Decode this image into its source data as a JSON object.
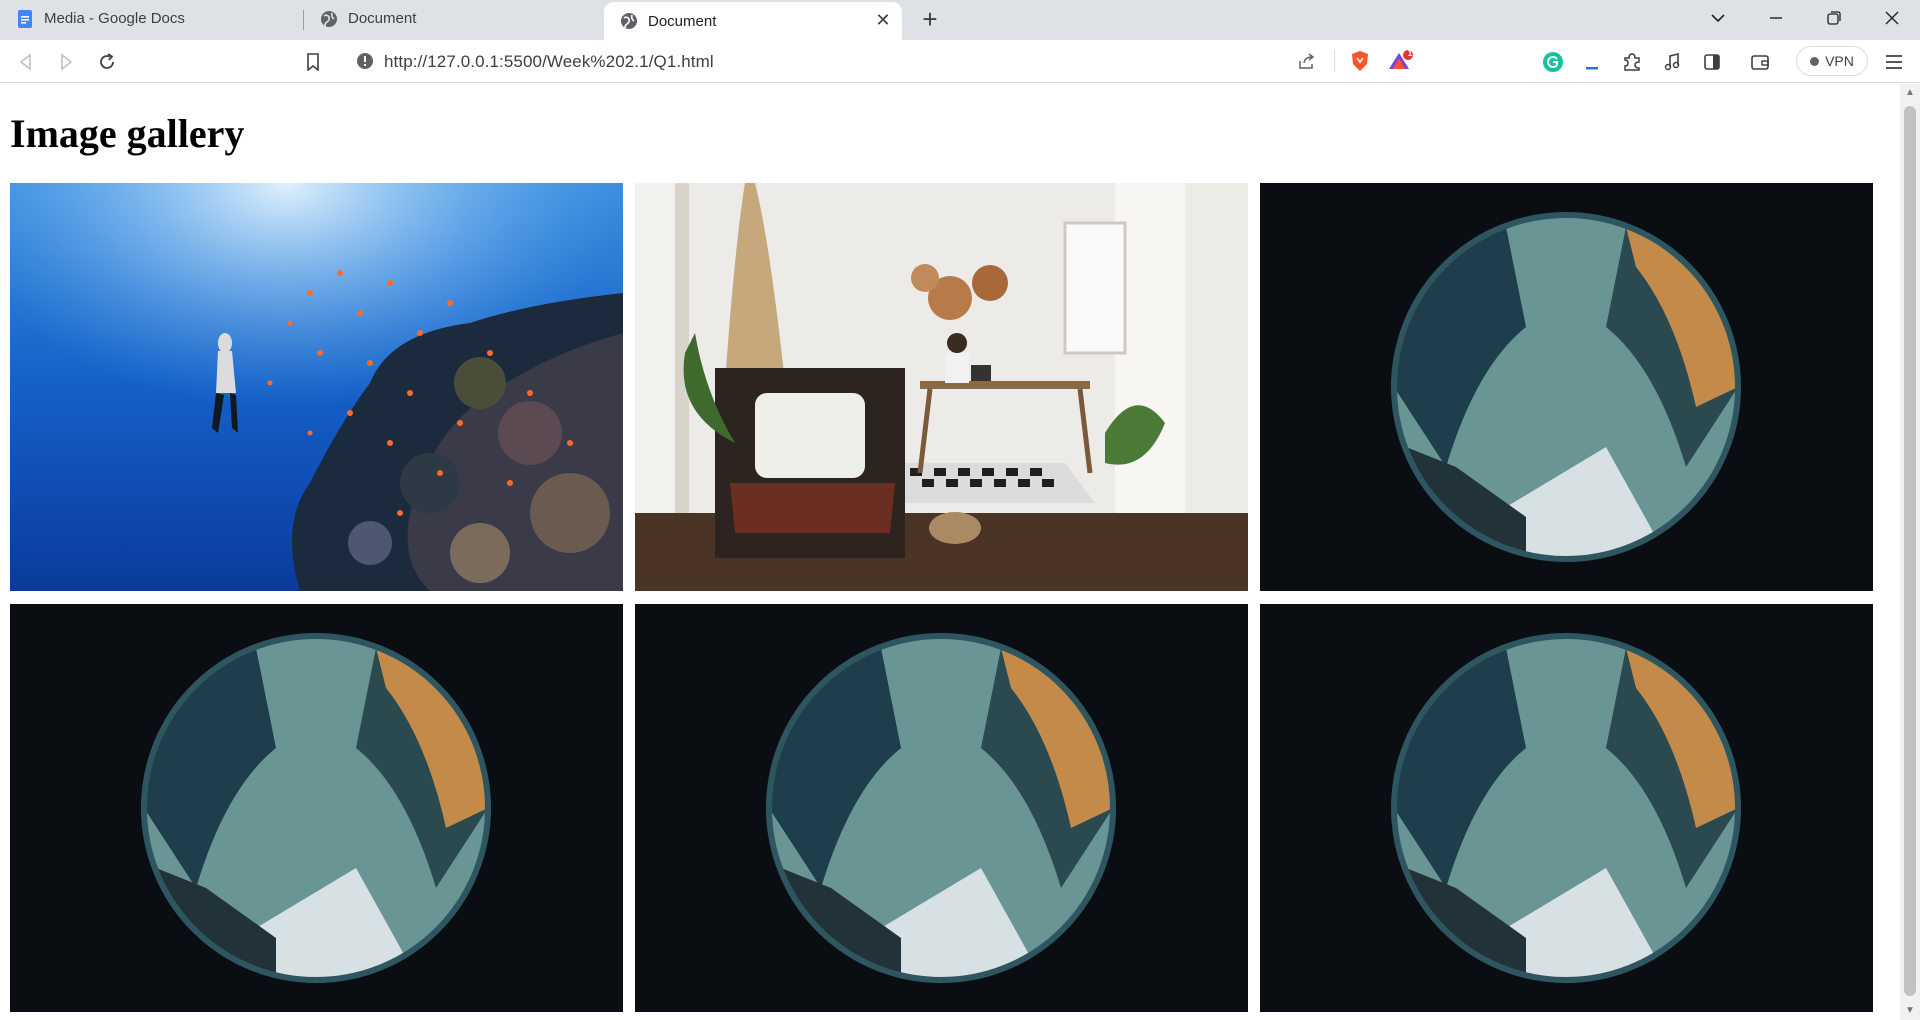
{
  "browser": {
    "tabs": [
      {
        "title": "Media - Google Docs",
        "favicon": "google-docs-icon",
        "active": false
      },
      {
        "title": "Document",
        "favicon": "globe-icon",
        "active": false
      },
      {
        "title": "Document",
        "favicon": "globe-icon",
        "active": true
      }
    ],
    "url": "http://127.0.0.1:5500/Week%202.1/Q1.html",
    "vpn_label": "VPN",
    "notification_count": "1"
  },
  "page": {
    "title": "Image gallery",
    "images": [
      {
        "subject": "scuba diver swimming beside coral reef with orange fish"
      },
      {
        "subject": "man working at desk in bright room with armchair"
      },
      {
        "subject": "fisheye view of city buildings against sky"
      },
      {
        "subject": "fisheye view of city buildings against sky"
      },
      {
        "subject": "fisheye view of city buildings against sky"
      },
      {
        "subject": "fisheye view of city buildings against sky"
      }
    ]
  },
  "colors": {
    "tabstrip": "#dee1e6",
    "brave_orange": "#fb542b",
    "grammarly_green": "#15c39a"
  }
}
